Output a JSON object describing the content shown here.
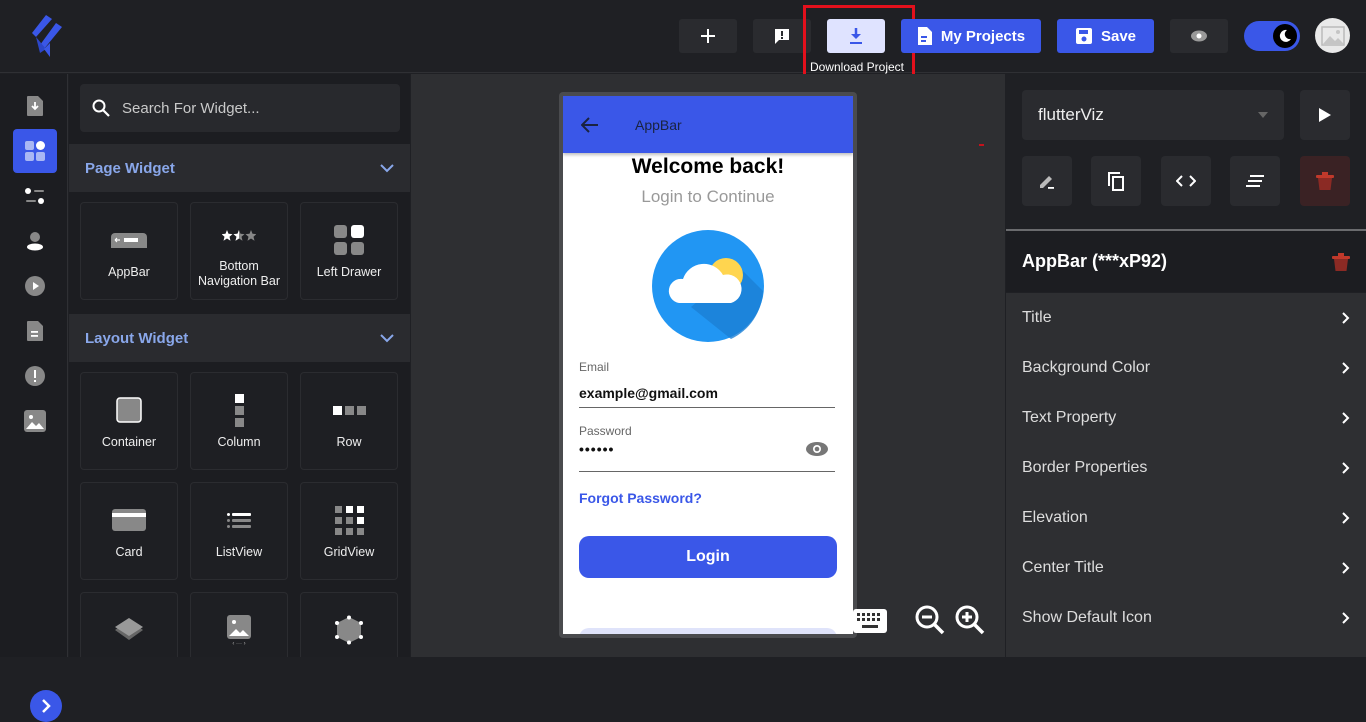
{
  "topbar": {
    "add_label": "+",
    "download_tooltip": "Download Project",
    "my_projects_label": "My Projects",
    "save_label": "Save",
    "theme_mode": "dark"
  },
  "rail": {
    "items": [
      {
        "icon": "file-download-icon",
        "active": false
      },
      {
        "icon": "widgets-icon",
        "active": true
      },
      {
        "icon": "settings-sliders-icon",
        "active": false
      },
      {
        "icon": "user-icon",
        "active": false
      },
      {
        "icon": "play-circle-icon",
        "active": false
      },
      {
        "icon": "document-icon",
        "active": false
      },
      {
        "icon": "alert-icon",
        "active": false
      },
      {
        "icon": "image-icon",
        "active": false
      }
    ]
  },
  "widgets": {
    "search_placeholder": "Search For Widget...",
    "sections": [
      {
        "title": "Page Widget",
        "items": [
          "AppBar",
          "Bottom Navigation Bar",
          "Left Drawer"
        ]
      },
      {
        "title": "Layout Widget",
        "items": [
          "Container",
          "Column",
          "Row",
          "Card",
          "ListView",
          "GridView",
          "Stack",
          "Image",
          "Transform"
        ]
      }
    ],
    "bottom_nav_line1": "Bottom",
    "bottom_nav_line2": "Navigation Bar"
  },
  "phone": {
    "appbar_title": "AppBar",
    "welcome": "Welcome back!",
    "subtitle": "Login to Continue",
    "email_label": "Email",
    "email_value": "example@gmail.com",
    "password_label": "Password",
    "password_value": "••••••",
    "forgot_label": "Forgot Password?",
    "login_label": "Login"
  },
  "properties": {
    "project_select": "flutterViz",
    "component_title": "AppBar (***xP92)",
    "items": [
      "Title",
      "Background Color",
      "Text Property",
      "Border Properties",
      "Elevation",
      "Center Title",
      "Show Default Icon"
    ]
  },
  "colors": {
    "accent": "#3a57e8",
    "section_title": "#89a7ea",
    "danger": "#c0392b",
    "highlight_box": "#e3101c"
  }
}
